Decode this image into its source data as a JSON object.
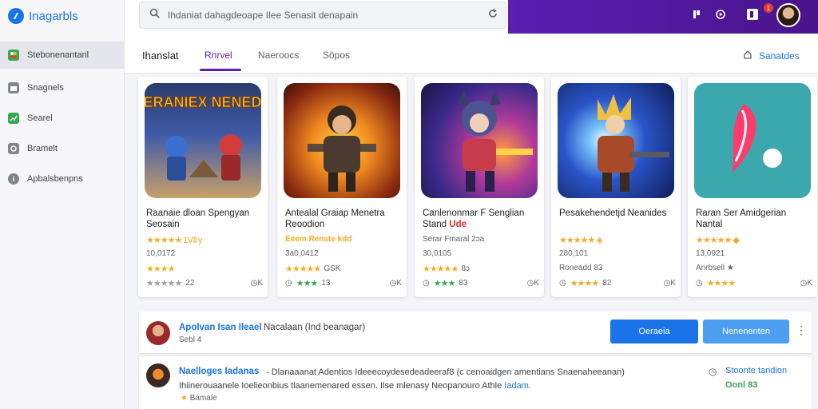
{
  "app": {
    "logo_text": "Inagarbls",
    "logo_accent": ""
  },
  "search": {
    "value": "Ihdaniat dahagdeoape Ilee Senasit denapain"
  },
  "sidebar": {
    "items": [
      {
        "label": "Stebonenantanl",
        "icon": "people-icon",
        "color": "#34a853"
      },
      {
        "label": "Snagnels",
        "icon": "folder-icon",
        "color": "#80868b"
      },
      {
        "label": "Searel",
        "icon": "chart-icon",
        "color": "#34a853"
      },
      {
        "label": "Bramelt",
        "icon": "gear-icon",
        "color": "#80868b"
      },
      {
        "label": "Apbalsbenpns",
        "icon": "info-icon",
        "color": "#80868b"
      }
    ]
  },
  "tabs": {
    "title": "Ihanslat",
    "items": [
      "Rnrvel",
      "Naeroocs",
      "Sôpos"
    ],
    "active_index": 0,
    "right_label": "Sanatdes"
  },
  "header": {
    "badge_count": "1"
  },
  "cards": [
    {
      "title": "Raanaie dloan Spengyan Seosain",
      "line1": "★★★★★ 1Ⅶ y",
      "line2": "10,0172",
      "line3_stars": "★★★★",
      "bottom_left_stars": "★★★★★",
      "bottom_left_text": "22",
      "bottom_right": "◷K",
      "thumb_title": "NERANIEX NENEDO"
    },
    {
      "title": "Antealal Graiap Menetra Reoodion",
      "line1": "Eeem Renste kdd",
      "line2": "3a0,0412",
      "line3_stars": "★★★★★",
      "line3_text": "GSK",
      "bottom_left_stars": "★★★",
      "bottom_left_text": "13",
      "bottom_right": "◷K"
    },
    {
      "title": "Canlenonmar F Senglian Stand",
      "title_tag": "Ude",
      "line1": "Serar Fmaral 2ɔa",
      "line2": "30,0105",
      "line3_stars": "★★★★★",
      "line3_text": "8ɔ",
      "bottom_left_stars": "★★★",
      "bottom_left_text": "83",
      "bottom_right": "◷K"
    },
    {
      "title": "Pesakehendetjd Neanides",
      "line1": "★★★★★ ◈",
      "line2": "280,101",
      "line3_text": "Roneadd 83",
      "bottom_left_stars": "★★★★",
      "bottom_left_text": "82",
      "bottom_right": "◷K"
    },
    {
      "title": "Raran Ser Amidgerian Nantal",
      "line1": "★★★★★ ◆",
      "line2": "13,0921",
      "line3_text": "Anrbsell ★",
      "bottom_left_stars": "★★★★",
      "bottom_left_text": "",
      "bottom_right": "◷K"
    }
  ],
  "rows": [
    {
      "title": "Apolvan Isan Ileael",
      "text": "Nacalaan (Ind beanagar)",
      "sub": "Sebl 4",
      "buttons": [
        "Oeraeia",
        "Nenenenten"
      ]
    },
    {
      "title": "Naelloges Iadanas",
      "text": "- Dlanaaanat Adentios Ideeecoydesedeadeeraf8 (c cenoaidgen amentians Snaenaheeanan)",
      "text2": "Ihiinerouaanele Ioelieonbius tlaanemenared essen. Ilse mlenasy Neopanouro Athle",
      "text2_link": "Iadam.",
      "sub": "Bamale",
      "right_top": "Stoonte tandion",
      "right_bottom": "Oonl 83"
    }
  ],
  "colors": {
    "accent": "#1a73e8",
    "purple": "#5b1fb3",
    "star": "#f9a825"
  }
}
